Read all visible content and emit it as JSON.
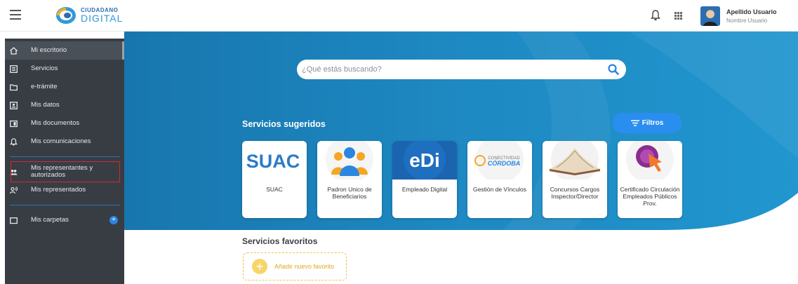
{
  "header": {
    "logo_line1": "CIUDADANO",
    "logo_line2": "DIGITAL",
    "user_name": "Apellido Usuario",
    "user_subtitle": "Nombre Usuario"
  },
  "sidebar": {
    "items": [
      {
        "label": "Mi escritorio",
        "icon": "home-icon"
      },
      {
        "label": "Servicios",
        "icon": "list-icon"
      },
      {
        "label": "e-trámite",
        "icon": "folder-icon"
      },
      {
        "label": "Mis datos",
        "icon": "id-card-icon"
      },
      {
        "label": "Mis documentos",
        "icon": "documents-icon"
      },
      {
        "label": "Mis comunicaciones",
        "icon": "bell-icon"
      },
      {
        "label": "Mis representantes y autorizados",
        "icon": "people-icon"
      },
      {
        "label": "Mis representados",
        "icon": "person-voice-icon"
      },
      {
        "label": "Mis carpetas",
        "icon": "folder-icon"
      }
    ]
  },
  "search": {
    "placeholder": "¿Qué estás buscando?"
  },
  "suggested": {
    "title": "Servicios sugeridos",
    "filter_label": "Filtros",
    "cards": [
      {
        "label": "SUAC",
        "thumb_text": "SUAC"
      },
      {
        "label": "Padron Unico de Beneficiarios",
        "thumb_text": ""
      },
      {
        "label": "Empleado Digital",
        "thumb_text": "eDi"
      },
      {
        "label": "Gestión de Vínculos",
        "thumb_text_1": "CONECTIVIDAD",
        "thumb_text_2": "CÓRDOBA"
      },
      {
        "label": "Concursos Cargos Inspector/Director",
        "thumb_text": ""
      },
      {
        "label": "Certificado Circulación Empleados Públicos Prov.",
        "thumb_text": ""
      }
    ]
  },
  "favorites": {
    "title": "Servicios favoritos",
    "add_label": "Añadir nuevo favorito"
  },
  "colors": {
    "banner_blue": "#1f8cc4",
    "sidebar_bg": "#383d44",
    "highlight_red": "#d8262d",
    "accent_blue": "#2a8ef0",
    "fav_yellow": "#f1c24a"
  }
}
